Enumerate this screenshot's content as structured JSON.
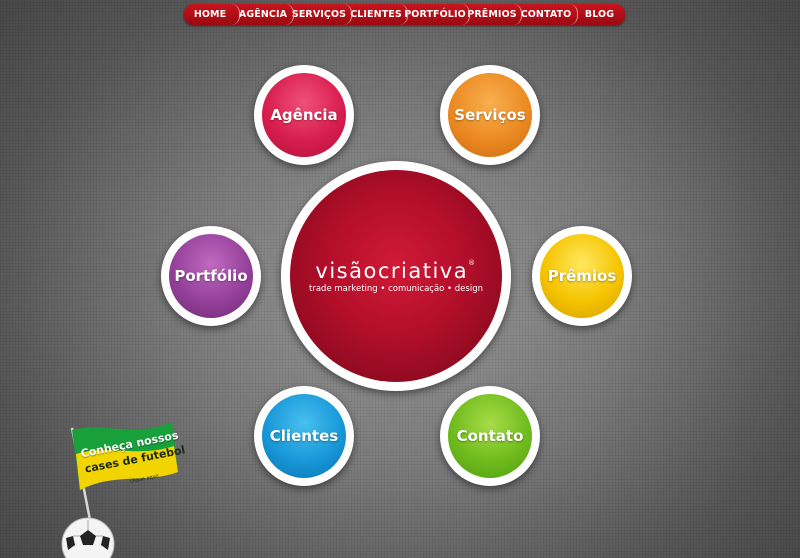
{
  "nav": {
    "items": [
      "HOME",
      "AGÊNCIA",
      "SERVIÇOS",
      "CLIENTES",
      "PORTFÓLIO",
      "PRÊMIOS",
      "CONTATO",
      "BLOG"
    ],
    "color": "#b3101a"
  },
  "center_logo": {
    "name": "visãocriativa",
    "tagline": "trade marketing • comunicação • design",
    "registered_mark": "®",
    "color": "#b20e2a"
  },
  "bubbles": {
    "agencia": {
      "label": "Agência",
      "color": "#d81e4e"
    },
    "servicos": {
      "label": "Serviços",
      "color": "#ec8a22"
    },
    "portfolio": {
      "label": "Portfólio",
      "color": "#95409a"
    },
    "premios": {
      "label": "Prêmios",
      "color": "#f5c400"
    },
    "clientes": {
      "label": "Clientes",
      "color": "#1898d8"
    },
    "contato": {
      "label": "Contato",
      "color": "#70bc1e"
    }
  },
  "promo_flag": {
    "line1": "Conheça nossos",
    "line2": "cases de futebol",
    "line3": "clique aqui!",
    "icons": [
      "brazil-flag-icon",
      "soccer-ball-icon"
    ]
  }
}
